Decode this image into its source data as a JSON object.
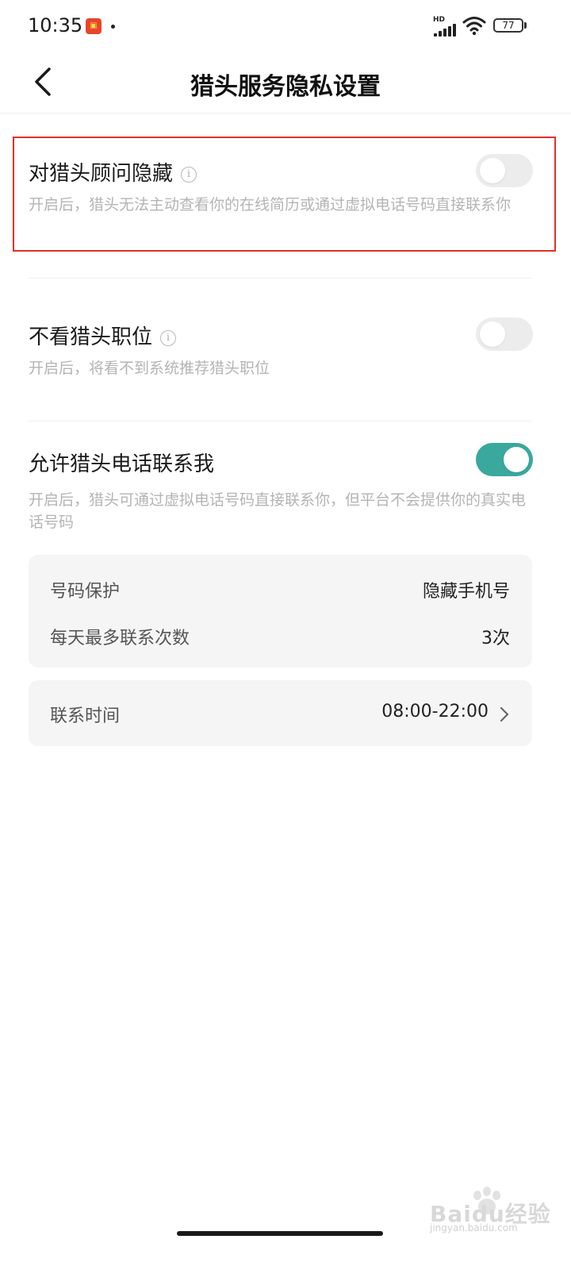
{
  "status_bar": {
    "time": "10:35",
    "network_label": "HD",
    "battery_level": "77"
  },
  "header": {
    "title": "猎头服务隐私设置"
  },
  "settings": [
    {
      "title": "对猎头顾问隐藏",
      "description": "开启后，猎头无法主动查看你的在线简历或通过虚拟电话号码直接联系你",
      "enabled": false
    },
    {
      "title": "不看猎头职位",
      "description": "开启后，将看不到系统推荐猎头职位",
      "enabled": false
    },
    {
      "title": "允许猎头电话联系我",
      "description": "开启后，猎头可通过虚拟电话号码直接联系你，但平台不会提供你的真实电话号码",
      "enabled": true
    }
  ],
  "phone_card": {
    "rows": [
      {
        "label": "号码保护",
        "value": "隐藏手机号"
      },
      {
        "label": "每天最多联系次数",
        "value": "3次"
      }
    ]
  },
  "time_card": {
    "label": "联系时间",
    "value": "08:00-22:00"
  },
  "watermark": {
    "text": "Baidu经验",
    "url": "jingyan.baidu.com"
  },
  "colors": {
    "toggle_on": "#3aa89c",
    "highlight_border": "#e0302a",
    "description_text": "#b4b4b4"
  }
}
